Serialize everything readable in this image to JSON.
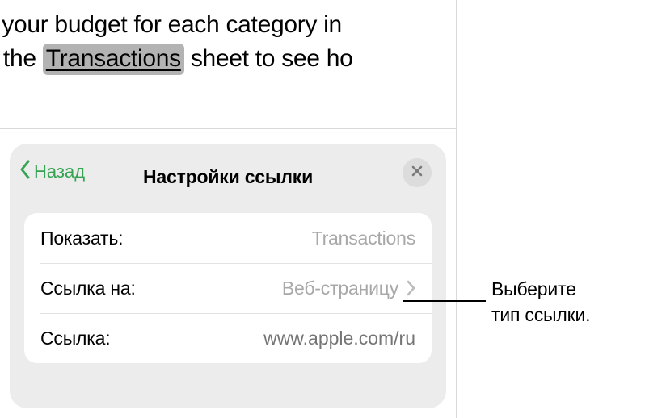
{
  "document": {
    "line1_prefix": "Enter your budget for each category in",
    "line2_prefix": "ns on the ",
    "highlighted_word": "Transactions",
    "line2_suffix": " sheet to see ho"
  },
  "panel": {
    "back_label": "Назад",
    "title": "Настройки ссылки",
    "rows": {
      "display": {
        "label": "Показать:",
        "value": "Transactions"
      },
      "link_to": {
        "label": "Ссылка на:",
        "value": "Веб-страницу"
      },
      "link": {
        "label": "Ссылка:",
        "placeholder": "www.apple.com/ru"
      }
    }
  },
  "callout": {
    "line1": "Выберите",
    "line2": "тип ссылки."
  }
}
